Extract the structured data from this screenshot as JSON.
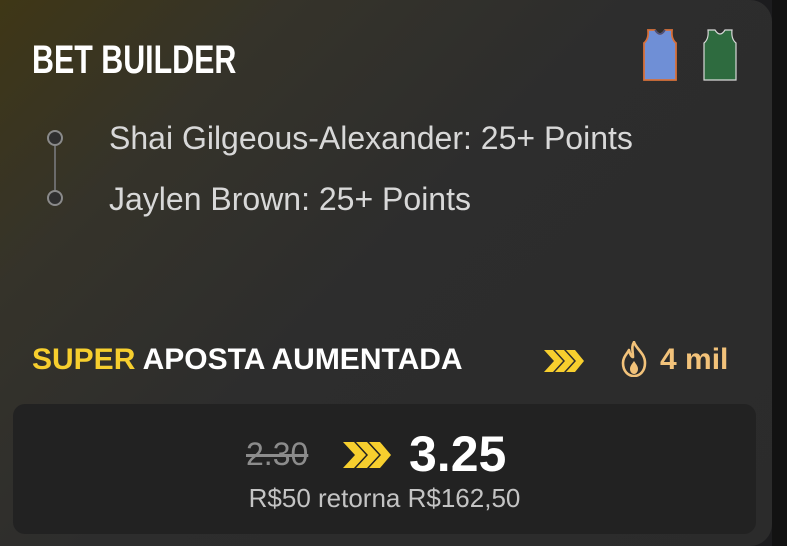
{
  "card": {
    "title": "BET BUILDER",
    "team_icons": [
      "thunder-jersey-icon",
      "celtics-jersey-icon"
    ]
  },
  "legs": [
    {
      "text": "Shai Gilgeous-Alexander: 25+ Points"
    },
    {
      "text": "Jaylen Brown: 25+ Points"
    }
  ],
  "promo": {
    "highlight": "SUPER",
    "label": "APOSTA AUMENTADA",
    "popularity": "4 mil",
    "icons": [
      "chevrons-right-icon",
      "flame-icon"
    ]
  },
  "odds": {
    "old": "2.30",
    "new": "3.25",
    "returns": "R$50 retorna R$162,50"
  },
  "colors": {
    "accent_yellow": "#f7cf2e",
    "popularity_orange": "#f2c27a",
    "thunder_blue": "#6f8fd6",
    "celtics_green": "#2e6b3f"
  }
}
